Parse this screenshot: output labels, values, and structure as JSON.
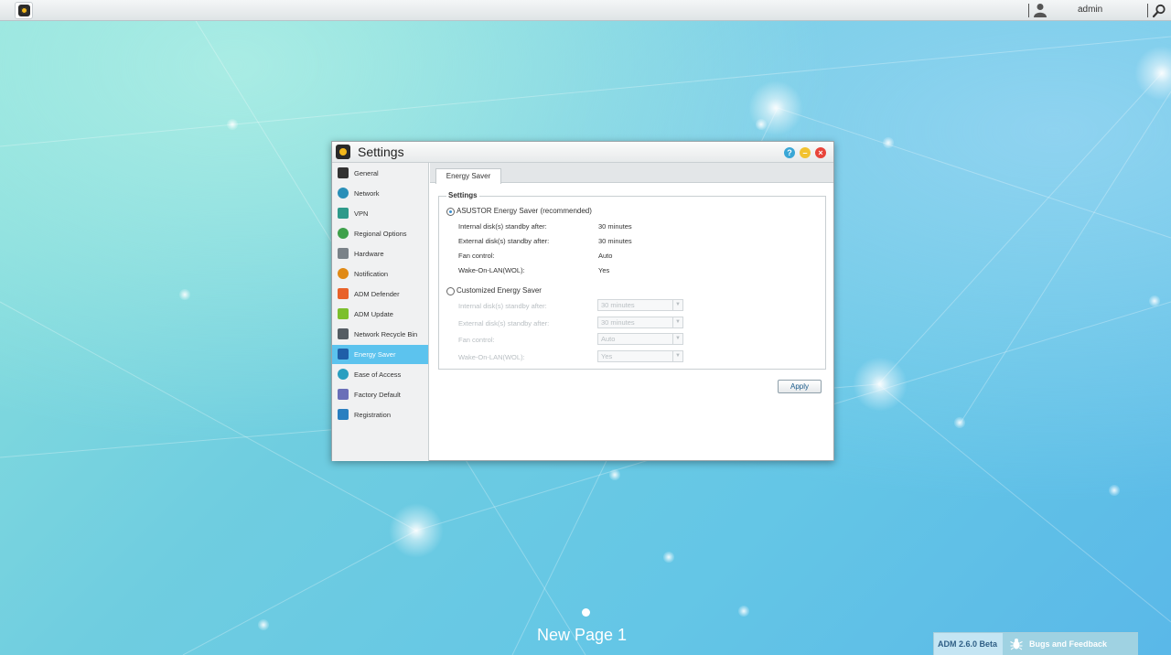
{
  "topbar": {
    "user_name": "admin",
    "icons": [
      "adm-logo-icon",
      "user-icon",
      "search-icon"
    ]
  },
  "window": {
    "title": "Settings",
    "controls": [
      "help-icon",
      "minimize-icon",
      "close-icon"
    ],
    "sidebar": {
      "items": [
        {
          "label": "General",
          "icon": "general-icon",
          "color": "#333333"
        },
        {
          "label": "Network",
          "icon": "globe-icon",
          "color": "#2a8fb8"
        },
        {
          "label": "VPN",
          "icon": "vpn-icon",
          "color": "#2e9a8a"
        },
        {
          "label": "Regional Options",
          "icon": "regional-icon",
          "color": "#3ea04b"
        },
        {
          "label": "Hardware",
          "icon": "hardware-icon",
          "color": "#7a8288"
        },
        {
          "label": "Notification",
          "icon": "notification-icon",
          "color": "#e08a16"
        },
        {
          "label": "ADM Defender",
          "icon": "defender-icon",
          "color": "#e8622a"
        },
        {
          "label": "ADM Update",
          "icon": "update-icon",
          "color": "#7cbf2e"
        },
        {
          "label": "Network Recycle Bin",
          "icon": "recycle-bin-icon",
          "color": "#555d63"
        },
        {
          "label": "Energy Saver",
          "icon": "energy-icon",
          "color": "#1f5fa8"
        },
        {
          "label": "Ease of Access",
          "icon": "cloud-icon",
          "color": "#2a9fc0"
        },
        {
          "label": "Factory Default",
          "icon": "reset-icon",
          "color": "#6a6fb8"
        },
        {
          "label": "Registration",
          "icon": "registration-icon",
          "color": "#2a7fc0"
        }
      ],
      "active_label": "Energy Saver"
    },
    "tab": "Energy Saver",
    "settings": {
      "legend": "Settings",
      "asustor": {
        "label": "ASUSTOR Energy Saver (recommended)",
        "selected": true,
        "rows": [
          {
            "label": "Internal disk(s) standby after:",
            "value": "30 minutes"
          },
          {
            "label": "External disk(s) standby after:",
            "value": "30 minutes"
          },
          {
            "label": "Fan control:",
            "value": "Auto"
          },
          {
            "label": "Wake-On-LAN(WOL):",
            "value": "Yes"
          }
        ]
      },
      "custom": {
        "label": "Customized Energy Saver",
        "selected": false,
        "rows": [
          {
            "label": "Internal disk(s) standby after:",
            "value": "30 minutes"
          },
          {
            "label": "External disk(s) standby after:",
            "value": "30 minutes"
          },
          {
            "label": "Fan control:",
            "value": "Auto"
          },
          {
            "label": "Wake-On-LAN(WOL):",
            "value": "Yes"
          }
        ]
      }
    },
    "apply_label": "Apply"
  },
  "desktop": {
    "page_label": "New Page 1"
  },
  "bottombar": {
    "version": "ADM 2.6.0 Beta",
    "feedback_label": "Bugs and Feedback"
  },
  "colors": {
    "accent": "#5cc3ee",
    "close": "#e8443a",
    "minimize": "#f2c230",
    "help": "#3aa7d6"
  }
}
